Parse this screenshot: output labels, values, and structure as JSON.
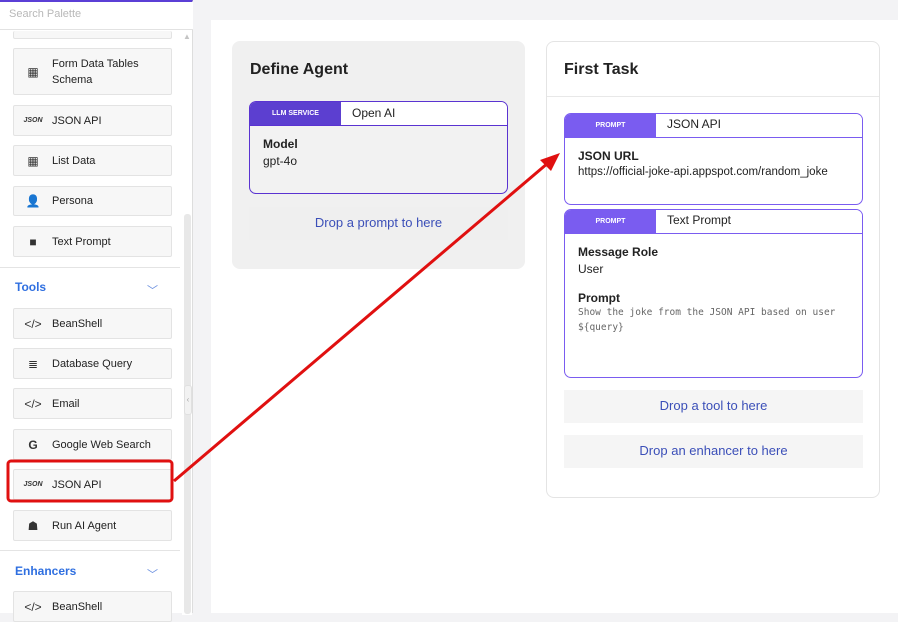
{
  "sidebar": {
    "search_placeholder": "Search Palette",
    "items_top": [
      {
        "label": "Form Data Tables Schema",
        "icon": "table-icon"
      },
      {
        "label": "JSON API",
        "icon": "json-icon"
      },
      {
        "label": "List Data",
        "icon": "table-icon"
      },
      {
        "label": "Persona",
        "icon": "persona-icon"
      },
      {
        "label": "Text Prompt",
        "icon": "comment-icon"
      }
    ],
    "tools_label": "Tools",
    "tools": [
      {
        "label": "BeanShell",
        "icon": "code-icon"
      },
      {
        "label": "Database Query",
        "icon": "database-icon"
      },
      {
        "label": "Email",
        "icon": "code-icon"
      },
      {
        "label": "Google Web Search",
        "icon": "google-icon"
      },
      {
        "label": "JSON API",
        "icon": "json-icon"
      },
      {
        "label": "Run AI Agent",
        "icon": "agent-icon"
      }
    ],
    "enhancers_label": "Enhancers",
    "enhancers": [
      {
        "label": "BeanShell",
        "icon": "code-icon"
      }
    ],
    "json_glyph": "JSON"
  },
  "agent": {
    "title": "Define Agent",
    "service_tag": "LLM SERVICE",
    "service_name": "Open AI",
    "model_label": "Model",
    "model_value": "gpt-4o",
    "drop_prompt": "Drop a prompt to here"
  },
  "task": {
    "title": "First Task",
    "json_card": {
      "tag": "PROMPT",
      "name": "JSON API",
      "url_label": "JSON URL",
      "url_value": "https://official-joke-api.appspot.com/random_joke"
    },
    "text_card": {
      "tag": "PROMPT",
      "name": "Text Prompt",
      "role_label": "Message Role",
      "role_value": "User",
      "prompt_label": "Prompt",
      "prompt_value": "Show the joke from the JSON API based on user ${query}"
    },
    "drop_tool": "Drop a tool to here",
    "drop_enhancer": "Drop an enhancer to here"
  },
  "colors": {
    "accent": "#5c3fd0",
    "highlight": "#e01010",
    "link": "#2f6fe0"
  }
}
